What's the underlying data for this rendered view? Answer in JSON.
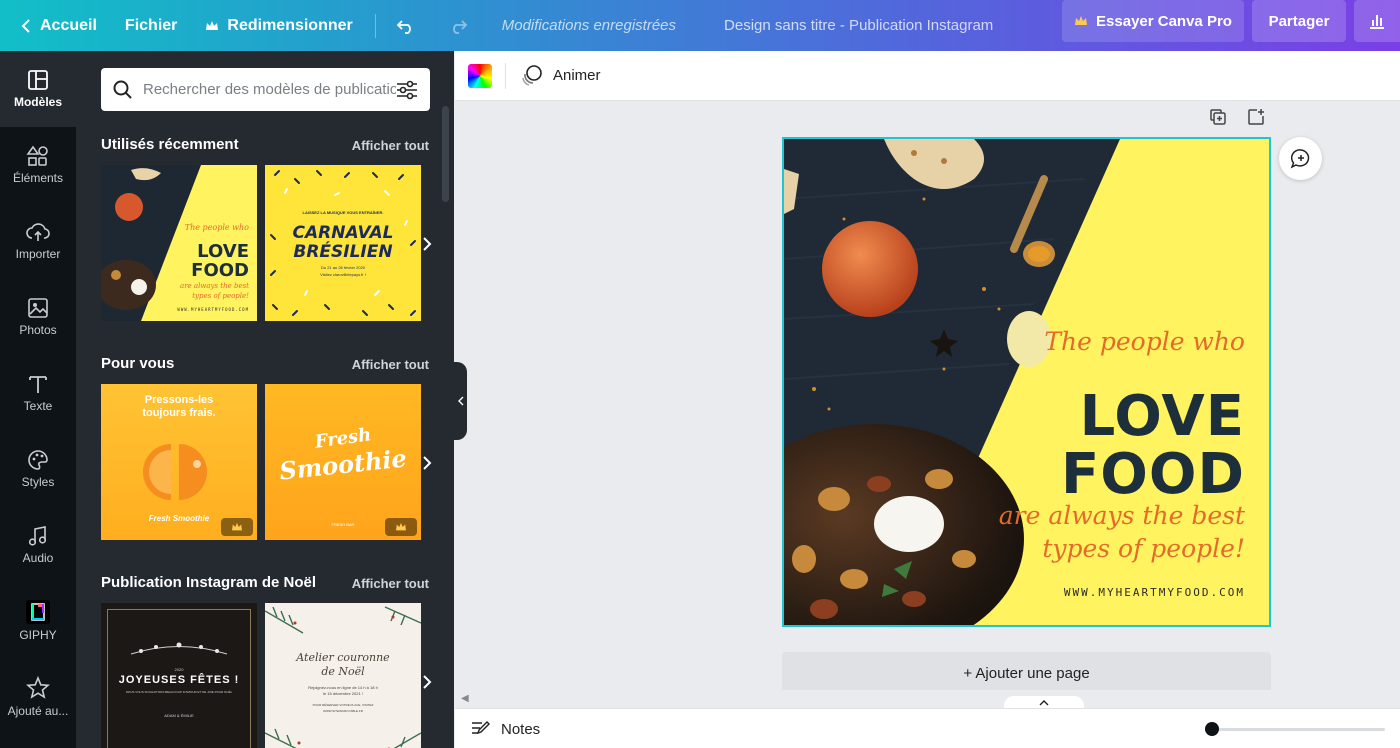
{
  "topbar": {
    "home": "Accueil",
    "file": "Fichier",
    "resize": "Redimensionner",
    "status": "Modifications enregistrées",
    "doc_title": "Design sans titre - Publication Instagram",
    "pro": "Essayer Canva Pro",
    "share": "Partager"
  },
  "rail": {
    "items": [
      {
        "label": "Modèles",
        "icon": "templates-icon",
        "active": true
      },
      {
        "label": "Éléments",
        "icon": "elements-icon"
      },
      {
        "label": "Importer",
        "icon": "upload-icon"
      },
      {
        "label": "Photos",
        "icon": "photos-icon"
      },
      {
        "label": "Texte",
        "icon": "text-icon"
      },
      {
        "label": "Styles",
        "icon": "palette-icon"
      },
      {
        "label": "Audio",
        "icon": "music-icon"
      },
      {
        "label": "GIPHY",
        "icon": "giphy-icon"
      },
      {
        "label": "Ajouté au...",
        "icon": "star-icon"
      }
    ]
  },
  "panel": {
    "search_placeholder": "Rechercher des modèles de publication",
    "sections": [
      {
        "title": "Utilisés récemment",
        "link": "Afficher tout"
      },
      {
        "title": "Pour vous",
        "link": "Afficher tout"
      },
      {
        "title": "Publication Instagram de Noël",
        "link": "Afficher tout"
      }
    ],
    "thumbs": {
      "t1": {
        "script": "The people who",
        "big1": "LOVE",
        "big2": "FOOD",
        "script2": "are always the best types of people!",
        "url": "WWW.MYHEARTMYFOOD.COM"
      },
      "t2": {
        "top": "LAISSEZ LA MUSIQUE VOUS ENTRAÎNER.",
        "title1": "CARNAVAL",
        "title2": "BRÉSILIEN",
        "small": "Du 21 au 26 février 2020",
        "small2": "Visitez clarovillelepays.fr !"
      },
      "t3": {
        "title": "Pressons-les toujours frais.",
        "brand": "Fresh Smoothie"
      },
      "t4": {
        "word1": "Fresh",
        "word2": "Smoothie",
        "small": "FRESH BAR"
      },
      "t5": {
        "year": "2020",
        "title": "JOYEUSES FÊTES !",
        "sub": "NOUS VOUS SOUHAITONS BEAUCOUP D'AMOUR ET DE JOIE POUR NOËL",
        "names": "ADAM & ÉMILIE"
      },
      "t6": {
        "title1": "Atelier couronne",
        "title2": "de Noël",
        "sub": "Rejoignez-nous en ligne de 14 h à 18 h",
        "sub2": "le 15 décembre 2021 !",
        "small": "POUR RÉSERVER VOTRE PLACE, VISITEZ",
        "url": "WWW.SITEINCROYABLE.FR"
      }
    }
  },
  "toolbar": {
    "animate": "Animer"
  },
  "design": {
    "script1": "The people who",
    "big1": "LOVE",
    "big2": "FOOD",
    "script2": "are always the best",
    "script3": "types of people!",
    "url": "WWW.MYHEARTMYFOOD.COM"
  },
  "canvas": {
    "add_page": "+ Ajouter une page"
  },
  "bottombar": {
    "notes": "Notes",
    "zoom_level": 0
  },
  "colors": {
    "design_yellow": "#fff35f",
    "design_dark": "#1d2f3a",
    "accent_orange": "#e36b2a",
    "panel_bg": "#252a31",
    "rail_bg": "#0e1318",
    "selection": "#1fc5d0"
  }
}
